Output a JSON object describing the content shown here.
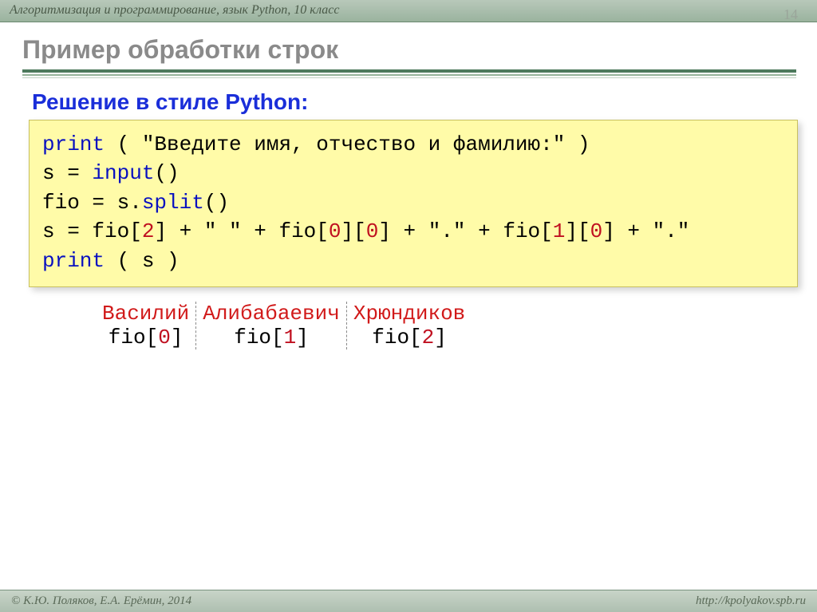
{
  "header": {
    "course": "Алгоритмизация и программирование, язык Python, 10 класс",
    "page_number": "14"
  },
  "title": "Пример обработки строк",
  "subtitle": "Решение в стиле Python:",
  "code": {
    "l1_kw": "print",
    "l1_rest": " ( \"Введите имя, отчество и фамилию:\" )",
    "l2_a": "s = ",
    "l2_kw": "input",
    "l2_b": "()",
    "l3_a": "fio = s.",
    "l3_kw": "split",
    "l3_b": "()",
    "l4_a": "s = fio[",
    "l4_n1": "2",
    "l4_b": "] + \" \" + fio[",
    "l4_n2": "0",
    "l4_c": "][",
    "l4_n3": "0",
    "l4_d": "] + \".\" + fio[",
    "l4_n4": "1",
    "l4_e": "][",
    "l4_n5": "0",
    "l4_f": "] + \".\"",
    "l5_kw": "print",
    "l5_rest": " ( s )"
  },
  "example": {
    "cols": [
      {
        "name": "Василий",
        "idx_a": "fio[",
        "idx_n": "0",
        "idx_b": "]"
      },
      {
        "name": "Алибабаевич",
        "idx_a": "fio[",
        "idx_n": "1",
        "idx_b": "]"
      },
      {
        "name": "Хрюндиков",
        "idx_a": "fio[",
        "idx_n": "2",
        "idx_b": "]"
      }
    ]
  },
  "footer": {
    "left": "© К.Ю. Поляков, Е.А. Ерёмин, 2014",
    "right": "http://kpolyakov.spb.ru"
  }
}
